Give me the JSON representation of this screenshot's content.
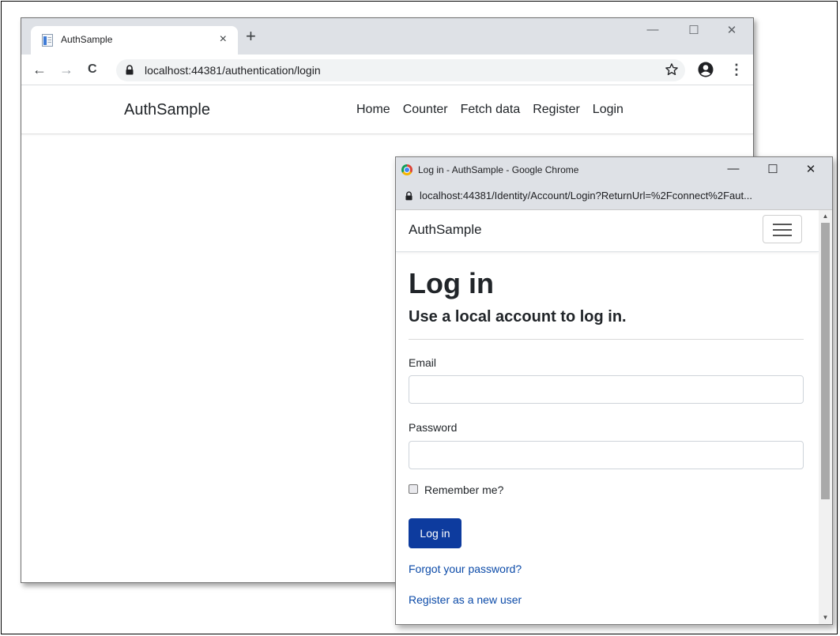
{
  "main_window": {
    "tab_title": "AuthSample",
    "tab_close": "×",
    "new_tab": "+",
    "window_controls": {
      "minimize": "—",
      "maximize": "☐",
      "close": "✕"
    },
    "nav": {
      "back": "←",
      "forward": "→",
      "reload": "C"
    },
    "url": "localhost:44381/authentication/login",
    "menu": "⋮",
    "app": {
      "brand": "AuthSample",
      "links": [
        "Home",
        "Counter",
        "Fetch data",
        "Register",
        "Login"
      ]
    }
  },
  "popup_window": {
    "title": "Log in - AuthSample - Google Chrome",
    "window_controls": {
      "minimize": "—",
      "maximize": "☐",
      "close": "✕"
    },
    "url": "localhost:44381/Identity/Account/Login?ReturnUrl=%2Fconnect%2Faut...",
    "brand": "AuthSample",
    "heading": "Log in",
    "subheading": "Use a local account to log in.",
    "email_label": "Email",
    "email_value": "",
    "password_label": "Password",
    "password_value": "",
    "remember_label": "Remember me?",
    "remember_checked": false,
    "submit_label": "Log in",
    "forgot_link": "Forgot your password?",
    "register_link": "Register as a new user",
    "scroll_up": "▲",
    "scroll_down": "▼"
  },
  "colors": {
    "primary_button": "#0d3b9e",
    "link": "#0b4aa8",
    "chrome_frame": "#dee1e6"
  }
}
